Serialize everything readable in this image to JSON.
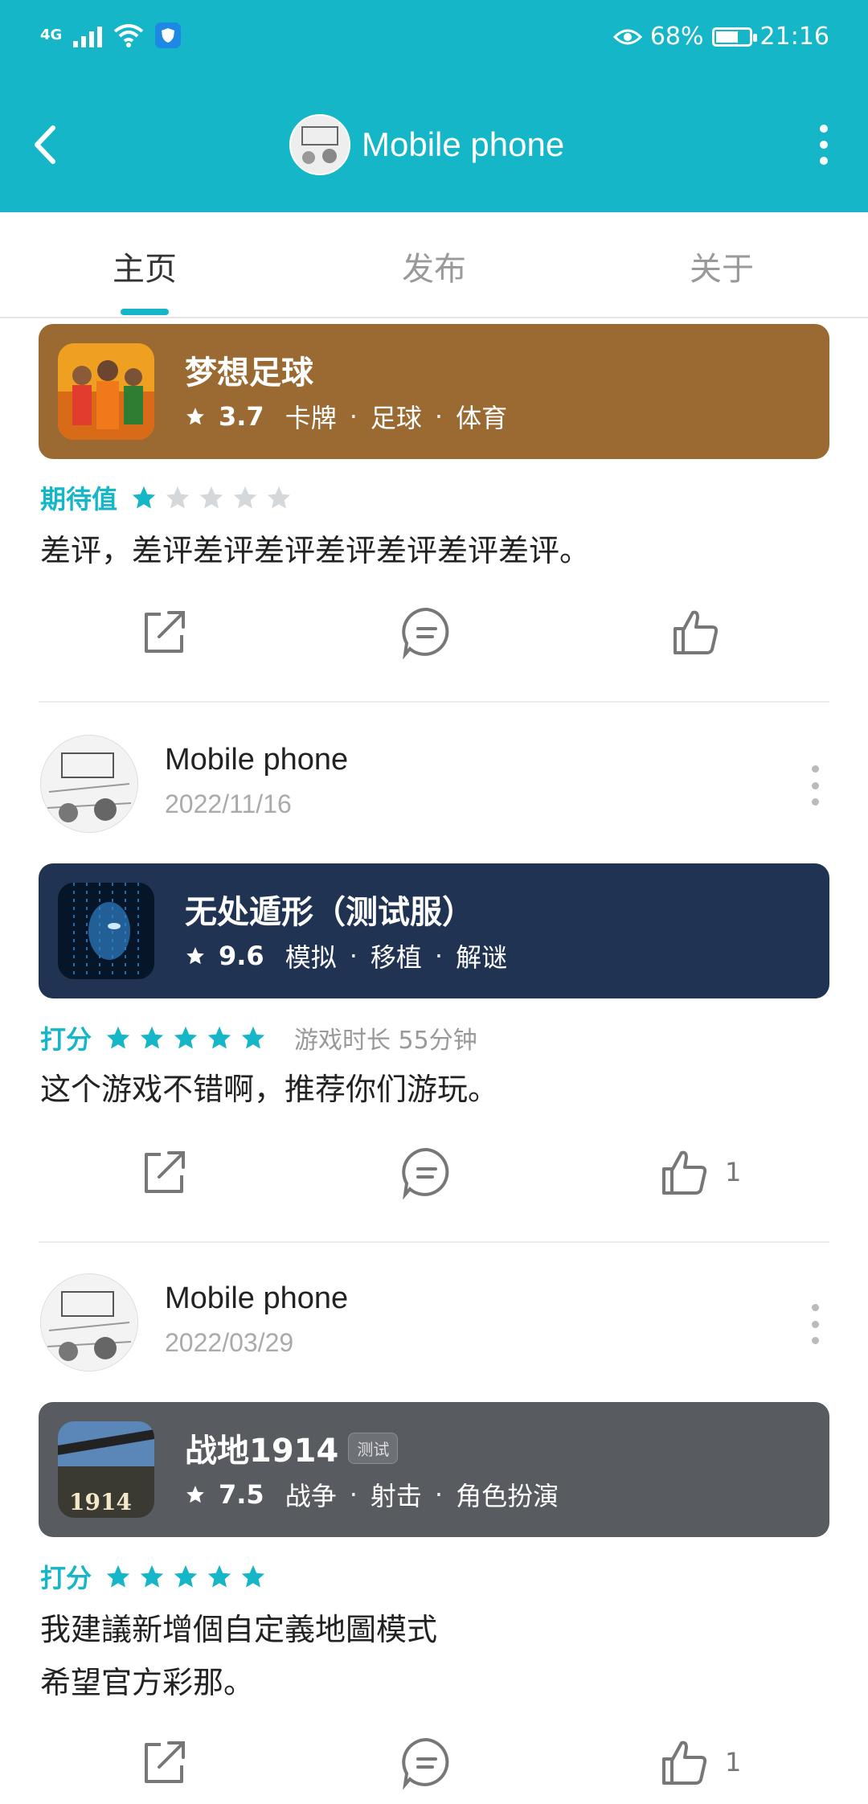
{
  "status_bar": {
    "network": "4G",
    "battery": "68%",
    "time": "21:16"
  },
  "header": {
    "title": "Mobile phone"
  },
  "tabs": [
    {
      "label": "主页",
      "active": true
    },
    {
      "label": "发布",
      "active": false
    },
    {
      "label": "关于",
      "active": false
    }
  ],
  "reviews": [
    {
      "game": {
        "name": "梦想足球",
        "score": "3.7",
        "tags": [
          "卡牌",
          "足球",
          "体育"
        ],
        "card_color": "#9a6a32"
      },
      "rating_label": "期待值",
      "stars": 1,
      "text": [
        "差评，差评差评差评差评差评差评差评。"
      ],
      "likes": ""
    },
    {
      "author": {
        "name": "Mobile phone",
        "date": "2022/11/16"
      },
      "game": {
        "name": "无处遁形（测试服）",
        "score": "9.6",
        "tags": [
          "模拟",
          "移植",
          "解谜"
        ],
        "card_color": "#213353"
      },
      "rating_label": "打分",
      "stars": 5,
      "play_time": "游戏时长 55分钟",
      "text": [
        "这个游戏不错啊，推荐你们游玩。"
      ],
      "likes": "1"
    },
    {
      "author": {
        "name": "Mobile phone",
        "date": "2022/03/29"
      },
      "game": {
        "name": "战地1914",
        "badge": "测试",
        "score": "7.5",
        "tags": [
          "战争",
          "射击",
          "角色扮演"
        ],
        "card_color": "#585c60",
        "icon_text": "1914"
      },
      "rating_label": "打分",
      "stars": 5,
      "text": [
        "我建議新增個自定義地圖模式",
        "希望官方彩那。"
      ],
      "likes": "1"
    }
  ],
  "colors": {
    "accent": "#14b6c8",
    "star_empty": "#d5d8db"
  }
}
